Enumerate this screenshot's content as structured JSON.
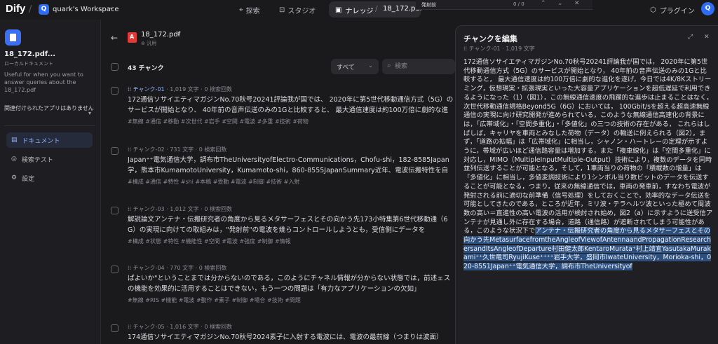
{
  "topbar": {
    "logo": "Dify",
    "workspace_initial": "Q",
    "workspace_name": "quark's Workspace",
    "nav": {
      "explore": "探索",
      "studio": "スタジオ",
      "knowledge": "ナレッジ",
      "current_doc": "18_172.pdf"
    },
    "find": {
      "query": "発射前",
      "count": "0 / 0"
    },
    "plugins": "プラグイン",
    "user_initial": "Q"
  },
  "sidebar": {
    "title": "18_172.pdf...",
    "subtitle": "ローカルドキュメント",
    "description": "Useful for when you want to answer queries about the 18_172.pdf",
    "apps_note": "関連付けられたアプリはありません",
    "menu": [
      {
        "label": "ドキュメント",
        "active": true
      },
      {
        "label": "検索テスト",
        "active": false
      },
      {
        "label": "設定",
        "active": false
      }
    ]
  },
  "main": {
    "doc_name": "18_172.pdf",
    "doc_mode": "汎用",
    "chunk_count": "43 チャンク",
    "filter": "すべて",
    "search_placeholder": "検索",
    "chunks": [
      {
        "id": "チャンク-01",
        "chars": "1,019 文字",
        "hits": "0 検索回数",
        "text": "172通信ソサイエティマガジンNo.70秋号20241評論我が国では、 2020年に第5世代移動通信方式（5G）のサービスが開始となり、 40年前の音声伝送のみの1Gと比較すると、 最大通信速度は約100万倍に劇的な進化を遂げ",
        "keywords": "#無線  #通信  #移動  #次世代  #岩手  #空間  #電波  #多重  #技術  #荷物"
      },
      {
        "id": "チャンク-02",
        "chars": "731 文字",
        "hits": "0 検索回数",
        "text": "Japan⁺⁺電気通信大学，調布市TheUniversityofElectro-Communications，Chofu-shi，182-8585Japan学，熊本市KumamotoUniversity，Kumamoto-shi，860-8555JapanSummary近年、電波伝搬特性を自",
        "keywords": "#構成  #通信  #特性  #shi  #本稿  #受動  #電波  #制御  #技術  #入射"
      },
      {
        "id": "チャンク-03",
        "chars": "1,012 文字",
        "hits": "0 検索回数",
        "text": "解説論文アンテナ・伝搬研究者の角度から見るメタサーフェスとその向かう先173小特集第6世代移動通（6G）の実現に向けての取組みは，\"発射前\"の電波を幾らコントロールしようとも，受信側にデータを",
        "keywords": "#構成  #状態  #特性  #機能性  #空間  #電波  #強度  #制御  #情報"
      },
      {
        "id": "チャンク-04",
        "chars": "770 文字",
        "hits": "0 検索回数",
        "text": "ぱよいか\"ということまでは分からないのである，このようにチャネル情報が分からない状態では，前述ェスの機能を効果的に活用することはできない，もう一つの問題は「有力なアプリケーションの欠如」",
        "keywords": "#無線  #RIS  #機能  #電波  #動作  #素子  #制御  #場合  #技術  #問題"
      },
      {
        "id": "チャンク-05",
        "chars": "1,016 文字",
        "hits": "0 検索回数",
        "text": "174通信ソサイエティマガジンNo.70秋号2024素子に入射する電波には、電波の最前線（つまりは波面）",
        "keywords": ""
      }
    ]
  },
  "editor": {
    "title": "チャンクを編集",
    "chunk_id": "チャンク-01",
    "chars": "1,019 文字",
    "body_plain": "172通信ソサイエティマガジンNo.70秋号20241評論我が国では， 2020年に第5世代移動通信方式（5G）のサービスが開始となり， 40年前の音声伝送のみの1Gと比較すると， 最大通信速度は約100万倍に劇的な進化を遂げ，今日では4K/8Kストリーミング，仮想現実・拡張現実といった大容量アプリケーションを超低遅延で利用できるようになった（1）（図1），この無線通信速度の飛躍的な進歩は止まることはなく，次世代移動通信規格Beyond5G（6G）においては， 100Gbit/sを超える超高速無線通信の実現に向け研究開発が進められている，このような無線通信高速化の背景には，「広帯域化」・「空間多重化」・「多値化」の三つの技術の存在がある， これらはしばしば，キャリヤを車両とみなした荷物（データ）の輸送に例えられる（図2），まず，「道路の拡幅」は「広帯域化」に相当し，シャノン・ハートレーの定理が示すように，帯域が広いほど通信路容量は増加する，また「複車線化」は「空間多重化」に対応し，MIMO（MultipleInputMultiple-Output）技術により，複数のデータを同時並列伝送することが可能となる，そして，1車両当りの荷物の「積載数の増量」は「多値化」に相当し，多値変調技術により1シンボル当り数ビットのデータを伝送することが可能となる，つまり，従来の無線通信では，車両の発車前，すなわち電波が発射される前に適切な前準備（信号処理）をしておくことで，効率的なデータ伝送を可能としてきたのである，ところが近年，ミリ波・テラヘルツ波といった極めて周波数の高い＝直進性の高い電波の活用が検討され始め，図2（a）に示すように送受信アンテナが見通し外に存在する場合，道路（通信路）が遮断されてしまう可能性がある，このような状況下で",
    "body_highlight": "アンテナ・伝搬研究者の角度から見るメタサーフェスとその向かう先MetasurfacefromtheAngleofViewofAntennaandPropagationResearchersandItsAngleofDeparture村田健太郎KentaroMurata⁺村上靖宜YasutakaMurakami⁺⁺久世竜司RyujiKuse⁺⁺⁺⁺岩手大学，盛岡市IwateUniversity，Morioka-shi，020-8551Japan⁺⁺電気通信大学，調布市TheUniversityof"
  }
}
